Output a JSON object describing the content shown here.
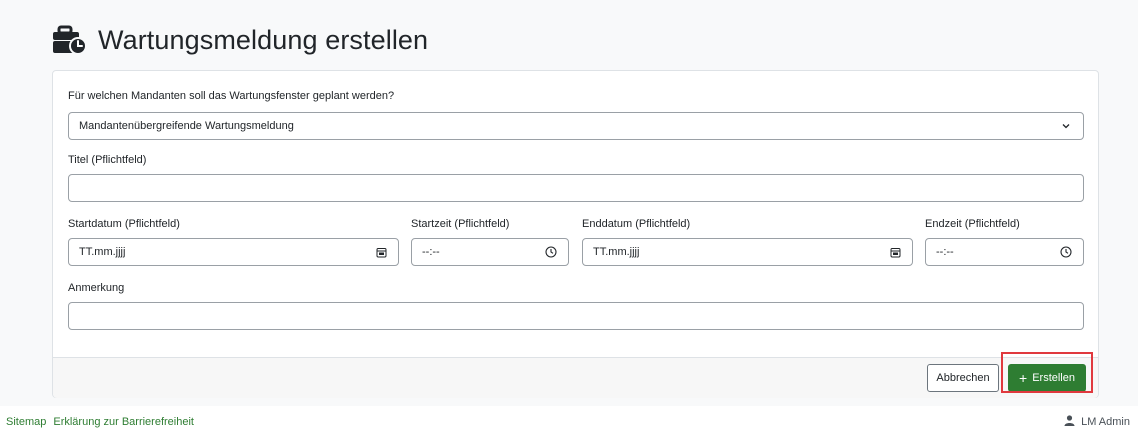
{
  "header": {
    "title": "Wartungsmeldung erstellen",
    "icon": "briefcase-clock-icon"
  },
  "form": {
    "tenant_label": "Für welchen Mandanten soll das Wartungsfenster geplant werden?",
    "tenant_value": "Mandantenübergreifende Wartungsmeldung",
    "title_label": "Titel (Pflichtfeld)",
    "title_value": "",
    "start_date_label": "Startdatum (Pflichtfeld)",
    "start_date_placeholder": "TT.mm.jjjj",
    "start_time_label": "Startzeit (Pflichtfeld)",
    "start_time_placeholder": "--:--",
    "end_date_label": "Enddatum (Pflichtfeld)",
    "end_date_placeholder": "TT.mm.jjjj",
    "end_time_label": "Endzeit (Pflichtfeld)",
    "end_time_placeholder": "--:--",
    "note_label": "Anmerkung",
    "note_value": ""
  },
  "actions": {
    "cancel_label": "Abbrechen",
    "create_label": "Erstellen",
    "create_color": "#2e7d32",
    "highlight_color": "#e0393e"
  },
  "footer": {
    "links": [
      "Sitemap",
      "Erklärung zur Barrierefreiheit"
    ],
    "user_name": "LM Admin"
  }
}
